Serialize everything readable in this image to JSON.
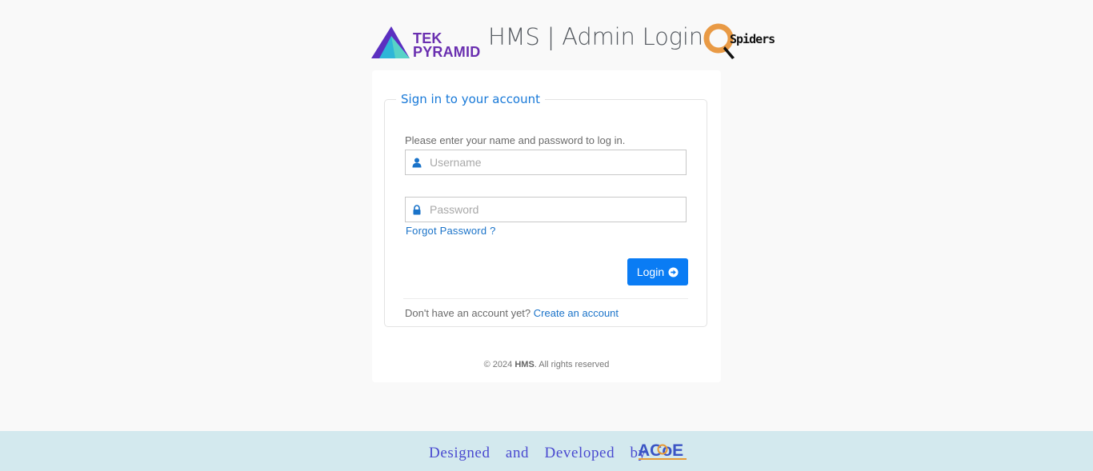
{
  "header": {
    "brand_left_line1": "TEK",
    "brand_left_line2": "PYRAMID",
    "title": "HMS | Admin Login",
    "brand_right": "Spiders"
  },
  "login": {
    "legend": "Sign in to your account",
    "intro": "Please enter your name and password to log in.",
    "username_placeholder": "Username",
    "username_value": "",
    "password_placeholder": "Password",
    "password_value": "",
    "forgot_label": "Forgot Password ?",
    "login_label": "Login",
    "no_account_text": "Don't have an account yet?",
    "create_account_label": "Create an account",
    "copyright_prefix": "© 2024",
    "copyright_brand": "HMS",
    "copyright_suffix": ". All rights reserved"
  },
  "footer": {
    "text": "Designed and Developed by",
    "logo_text": "ACoE"
  },
  "icons": {
    "username": "user-icon",
    "password": "lock-icon",
    "login": "arrow-circle-right-icon"
  },
  "colors": {
    "accent": "#0a7cf4",
    "link": "#1a73c9",
    "legend": "#1879d8",
    "brand_purple": "#6a2fb0",
    "footer_bg": "#d3e9ee",
    "footer_text": "#4a4ad0"
  }
}
